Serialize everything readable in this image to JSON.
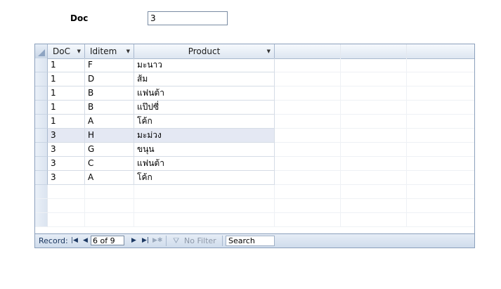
{
  "form": {
    "doc_label": "Doc",
    "doc_value": "3"
  },
  "datasheet": {
    "columns": [
      {
        "label": "DoC",
        "dropdown_icon": "chevron-down-icon"
      },
      {
        "label": "Iditem",
        "dropdown_icon": "chevron-down-icon"
      },
      {
        "label": "Product",
        "dropdown_icon": "chevron-down-icon"
      }
    ],
    "rows": [
      [
        "1",
        "F",
        "มะนาว"
      ],
      [
        "1",
        "D",
        "ส้ม"
      ],
      [
        "1",
        "B",
        "แฟนต้า"
      ],
      [
        "1",
        "B",
        "แป๊ปซี่"
      ],
      [
        "1",
        "A",
        "โค้ก"
      ],
      [
        "3",
        "H",
        "มะม่วง"
      ],
      [
        "3",
        "G",
        "ขนุน"
      ],
      [
        "3",
        "C",
        "แฟนต้า"
      ],
      [
        "3",
        "A",
        "โค้ก"
      ]
    ],
    "current_row_index": 5,
    "selection_color": "#e4e8f3"
  },
  "navigation": {
    "record_label": "Record:",
    "first_icon": "first-record-icon",
    "prev_icon": "previous-record-icon",
    "position_text": "6 of 9",
    "next_icon": "next-record-icon",
    "last_icon": "last-record-icon",
    "new_icon": "new-record-icon",
    "filter_icon": "filter-icon",
    "filter_label": "No Filter",
    "search_label": "Search"
  }
}
